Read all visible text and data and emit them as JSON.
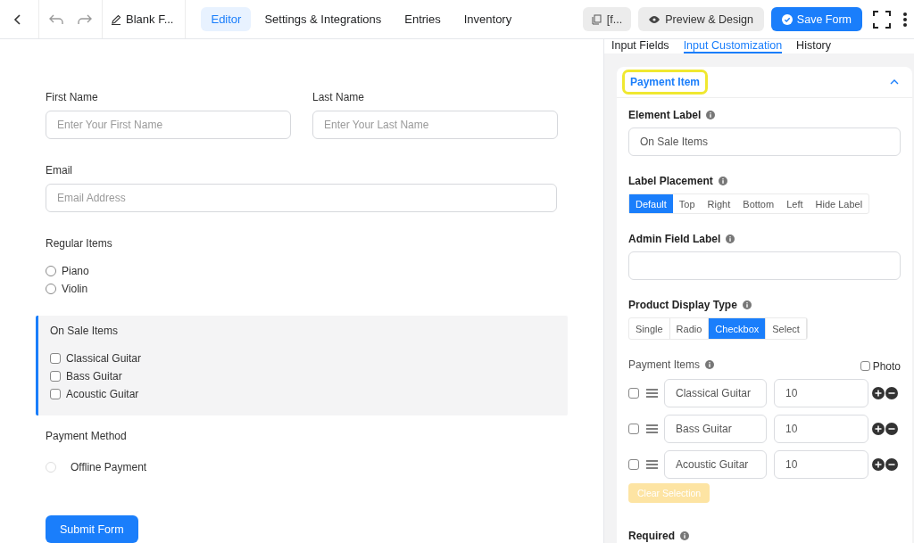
{
  "toolbar": {
    "form_title": "Blank F...",
    "nav_tabs": [
      {
        "label": "Editor",
        "selected": true
      },
      {
        "label": "Settings & Integrations",
        "selected": false
      },
      {
        "label": "Entries",
        "selected": false
      },
      {
        "label": "Inventory",
        "selected": false
      }
    ],
    "shortcode_button": "[f...",
    "preview_button": "Preview & Design",
    "save_button": "Save Form"
  },
  "form": {
    "name_fields": [
      {
        "label": "First Name",
        "placeholder": "Enter Your First Name"
      },
      {
        "label": "Last Name",
        "placeholder": "Enter Your Last Name"
      }
    ],
    "email": {
      "label": "Email",
      "placeholder": "Email Address"
    },
    "regular_items": {
      "label": "Regular Items",
      "options": [
        {
          "label": "Piano",
          "selected": false
        },
        {
          "label": "Violin",
          "selected": false
        }
      ]
    },
    "on_sale_items": {
      "label": "On Sale Items",
      "active": true,
      "options": [
        {
          "label": "Classical Guitar",
          "checked": false
        },
        {
          "label": "Bass Guitar",
          "checked": false
        },
        {
          "label": "Acoustic Guitar",
          "checked": false
        }
      ]
    },
    "payment_method": {
      "label": "Payment Method",
      "options": [
        {
          "label": "Offline Payment",
          "selected": false
        }
      ]
    },
    "submit_button": "Submit Form"
  },
  "panel": {
    "tabs": [
      {
        "label": "Input Fields",
        "selected": false
      },
      {
        "label": "Input Customization",
        "selected": true
      },
      {
        "label": "History",
        "selected": false
      }
    ],
    "card": {
      "title": "Payment Item",
      "expanded": true,
      "element_label": {
        "label": "Element Label",
        "value": "On Sale Items"
      },
      "label_placement": {
        "label": "Label Placement",
        "options": [
          {
            "label": "Default",
            "selected": true
          },
          {
            "label": "Top",
            "selected": false
          },
          {
            "label": "Right",
            "selected": false
          },
          {
            "label": "Bottom",
            "selected": false
          },
          {
            "label": "Left",
            "selected": false
          },
          {
            "label": "Hide Label",
            "selected": false
          }
        ]
      },
      "admin_field_label": {
        "label": "Admin Field Label"
      },
      "product_display_type": {
        "label": "Product Display Type",
        "options": [
          {
            "label": "Single",
            "selected": false
          },
          {
            "label": "Radio",
            "selected": false
          },
          {
            "label": "Checkbox",
            "selected": true
          },
          {
            "label": "Select",
            "selected": false
          }
        ]
      },
      "payment_items": {
        "label": "Payment Items",
        "photo": {
          "label": "Photo",
          "checked": false
        },
        "items": [
          {
            "checked": false,
            "name": "Classical Guitar",
            "price": "10"
          },
          {
            "checked": false,
            "name": "Bass Guitar",
            "price": "10"
          },
          {
            "checked": false,
            "name": "Acoustic Guitar",
            "price": "10"
          }
        ],
        "clear_button": {
          "label": "Clear Selection",
          "disabled": true
        }
      },
      "required": {
        "label": "Required"
      }
    }
  }
}
